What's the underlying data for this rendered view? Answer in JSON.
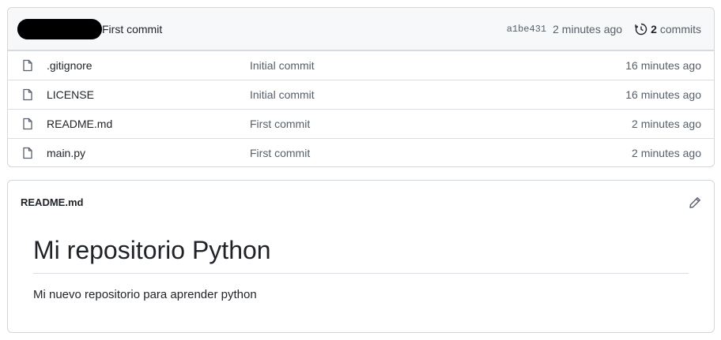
{
  "latest_commit": {
    "message": "First commit",
    "sha": "a1be431",
    "time": "2 minutes ago",
    "commits_count": "2",
    "commits_word": "commits"
  },
  "files": [
    {
      "name": ".gitignore",
      "message": "Initial commit",
      "age": "16 minutes ago",
      "icon": "file-icon"
    },
    {
      "name": "LICENSE",
      "message": "Initial commit",
      "age": "16 minutes ago",
      "icon": "file-icon"
    },
    {
      "name": "README.md",
      "message": "First commit",
      "age": "2 minutes ago",
      "icon": "file-icon"
    },
    {
      "name": "main.py",
      "message": "First commit",
      "age": "2 minutes ago",
      "icon": "file-icon"
    }
  ],
  "readme": {
    "filename": "README.md",
    "heading": "Mi repositorio Python",
    "body": "Mi nuevo repositorio para aprender python"
  }
}
